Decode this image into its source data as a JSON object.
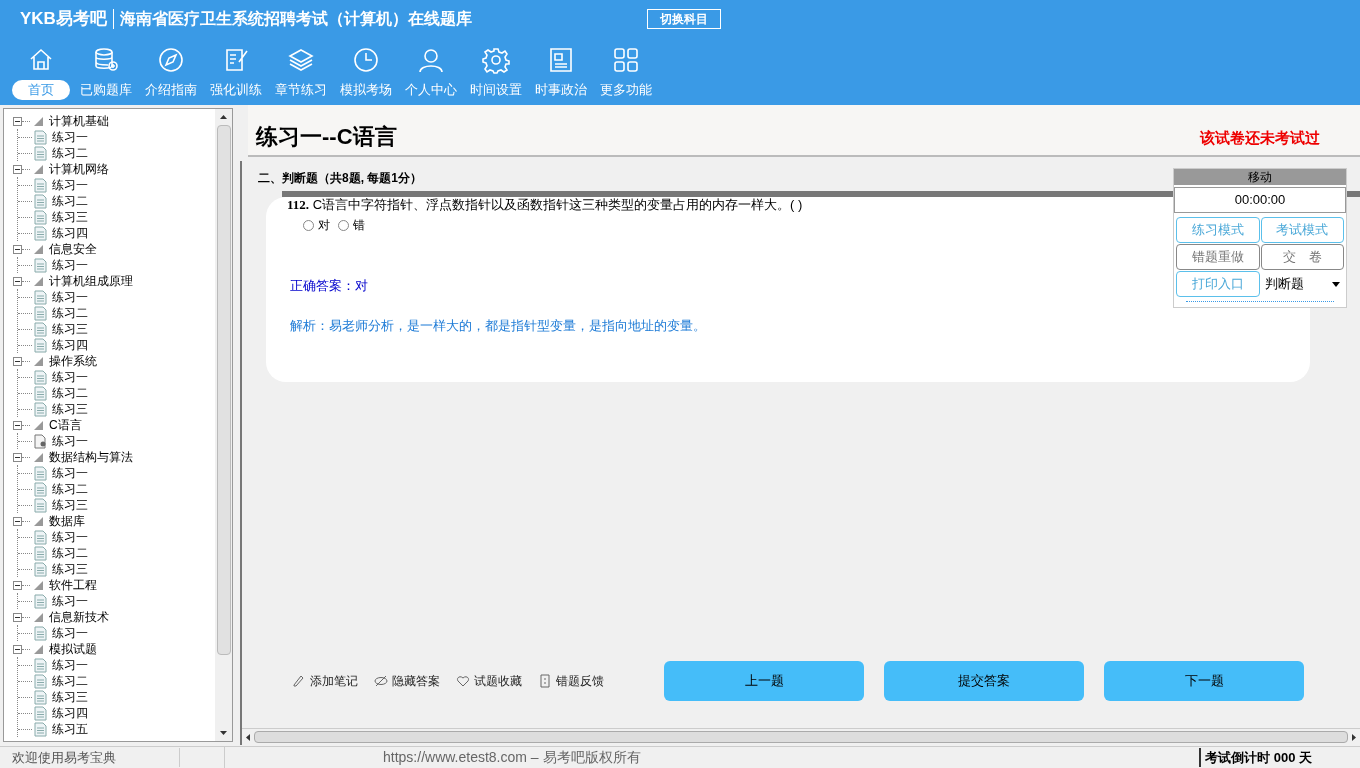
{
  "header": {
    "logo": "YKB易考吧",
    "title": "海南省医疗卫生系统招聘考试（计算机）在线题库",
    "switch_button": "切换科目"
  },
  "nav": [
    {
      "label": "首页",
      "selected": true
    },
    {
      "label": "已购题库",
      "selected": false
    },
    {
      "label": "介绍指南",
      "selected": false
    },
    {
      "label": "强化训练",
      "selected": false
    },
    {
      "label": "章节练习",
      "selected": false
    },
    {
      "label": "模拟考场",
      "selected": false
    },
    {
      "label": "个人中心",
      "selected": false
    },
    {
      "label": "时间设置",
      "selected": false
    },
    {
      "label": "时事政治",
      "selected": false
    },
    {
      "label": "更多功能",
      "selected": false
    }
  ],
  "tree": [
    {
      "label": "计算机基础",
      "expanded": true,
      "children": [
        {
          "label": "练习一",
          "selected": false
        },
        {
          "label": "练习二",
          "selected": false
        }
      ]
    },
    {
      "label": "计算机网络",
      "expanded": true,
      "children": [
        {
          "label": "练习一",
          "selected": false
        },
        {
          "label": "练习二",
          "selected": false
        },
        {
          "label": "练习三",
          "selected": false
        },
        {
          "label": "练习四",
          "selected": false
        }
      ]
    },
    {
      "label": "信息安全",
      "expanded": true,
      "children": [
        {
          "label": "练习一",
          "selected": false
        }
      ]
    },
    {
      "label": "计算机组成原理",
      "expanded": true,
      "children": [
        {
          "label": "练习一",
          "selected": false
        },
        {
          "label": "练习二",
          "selected": false
        },
        {
          "label": "练习三",
          "selected": false
        },
        {
          "label": "练习四",
          "selected": false
        }
      ]
    },
    {
      "label": "操作系统",
      "expanded": true,
      "children": [
        {
          "label": "练习一",
          "selected": false
        },
        {
          "label": "练习二",
          "selected": false
        },
        {
          "label": "练习三",
          "selected": false
        }
      ]
    },
    {
      "label": "C语言",
      "expanded": true,
      "children": [
        {
          "label": "练习一",
          "selected": true
        }
      ]
    },
    {
      "label": "数据结构与算法",
      "expanded": true,
      "children": [
        {
          "label": "练习一",
          "selected": false
        },
        {
          "label": "练习二",
          "selected": false
        },
        {
          "label": "练习三",
          "selected": false
        }
      ]
    },
    {
      "label": "数据库",
      "expanded": true,
      "children": [
        {
          "label": "练习一",
          "selected": false
        },
        {
          "label": "练习二",
          "selected": false
        },
        {
          "label": "练习三",
          "selected": false
        }
      ]
    },
    {
      "label": "软件工程",
      "expanded": true,
      "children": [
        {
          "label": "练习一",
          "selected": false
        }
      ]
    },
    {
      "label": "信息新技术",
      "expanded": true,
      "children": [
        {
          "label": "练习一",
          "selected": false
        }
      ]
    },
    {
      "label": "模拟试题",
      "expanded": true,
      "children": [
        {
          "label": "练习一",
          "selected": false
        },
        {
          "label": "练习二",
          "selected": false
        },
        {
          "label": "练习三",
          "selected": false
        },
        {
          "label": "练习四",
          "selected": false
        },
        {
          "label": "练习五",
          "selected": false
        }
      ]
    }
  ],
  "paper": {
    "title": "练习一--C语言",
    "status": "该试卷还未考试过",
    "section": "二、判断题（共8题, 每题1分）",
    "question": {
      "number": "112.",
      "text": "C语言中字符指针、浮点数指针以及函数指针这三种类型的变量占用的内存一样大。( )",
      "options": [
        {
          "label": "对",
          "selected": false
        },
        {
          "label": "错",
          "selected": false
        }
      ],
      "answer": "正确答案：对",
      "analysis": "解析：易老师分析，是一样大的，都是指针型变量，是指向地址的变量。"
    },
    "actions": [
      "添加笔记",
      "隐藏答案",
      "试题收藏",
      "错题反馈"
    ],
    "buttons": [
      "上一题",
      "提交答案",
      "下一题"
    ]
  },
  "panel": {
    "title": "移动",
    "timer": "00:00:00",
    "buttons": [
      {
        "label": "练习模式",
        "kind": "blue"
      },
      {
        "label": "考试模式",
        "kind": "blue"
      },
      {
        "label": "错题重做",
        "kind": "gray"
      },
      {
        "label": "交　卷",
        "kind": "gray"
      },
      {
        "label": "打印入口",
        "kind": "blue"
      }
    ],
    "type_select": "判断题"
  },
  "status_bar": {
    "welcome": "欢迎使用易考宝典",
    "copyright": "https://www.etest8.com – 易考吧版权所有",
    "countdown": "考试倒计时 000 天"
  }
}
